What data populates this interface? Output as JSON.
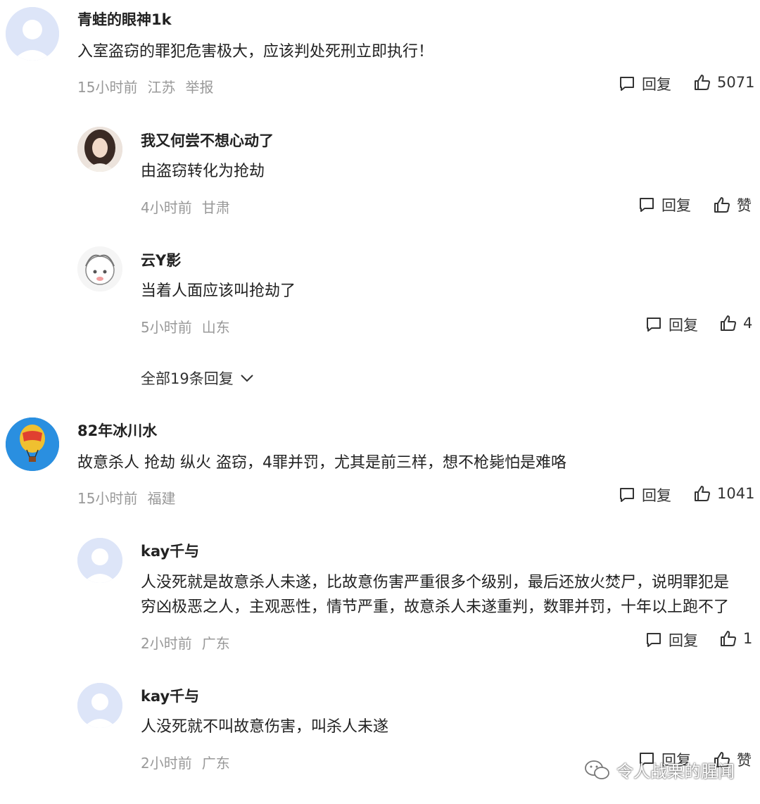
{
  "comments": [
    {
      "username": "青蛙的眼神1k",
      "text": "入室盗窃的罪犯危害极大，应该判处死刑立即执行！",
      "time": "15小时前",
      "location": "江苏",
      "report": "举报",
      "reply_label": "回复",
      "likes": "5071",
      "avatar_icon": "default-user-avatar"
    },
    {
      "username": "我又何尝不想心动了",
      "text": "由盗窃转化为抢劫",
      "time": "4小时前",
      "location": "甘肃",
      "reply_label": "回复",
      "likes": "赞",
      "avatar_icon": "photo-avatar"
    },
    {
      "username": "云Y影",
      "text": "当着人面应该叫抢劫了",
      "time": "5小时前",
      "location": "山东",
      "reply_label": "回复",
      "likes": "4",
      "avatar_icon": "anime-avatar"
    },
    {
      "username": "82年冰川水",
      "text": "故意杀人 抢劫 纵火 盗窃，4罪并罚，尤其是前三样，想不枪毙怕是难咯",
      "time": "15小时前",
      "location": "福建",
      "reply_label": "回复",
      "likes": "1041",
      "avatar_icon": "hot-air-balloon-avatar"
    },
    {
      "username": "kay千与",
      "text_line1": "人没死就是故意杀人未遂，比故意伤害严重很多个级别，最后还放火焚尸，说明罪犯是",
      "text_line2": "穷凶极恶之人，主观恶性，情节严重，故意杀人未遂重判，数罪并罚，十年以上跑不了",
      "time": "2小时前",
      "location": "广东",
      "reply_label": "回复",
      "likes": "1",
      "avatar_icon": "default-user-avatar"
    },
    {
      "username": "kay千与",
      "text": "人没死就不叫故意伤害，叫杀人未遂",
      "time": "2小时前",
      "location": "广东",
      "reply_label": "回复",
      "likes": "赞",
      "avatar_icon": "default-user-avatar"
    }
  ],
  "more_replies": "全部19条回复",
  "watermark": "令人战栗的腥闻",
  "colors": {
    "meta": "#999999",
    "text": "#222222",
    "avatar_bg": "#dde5f8"
  }
}
